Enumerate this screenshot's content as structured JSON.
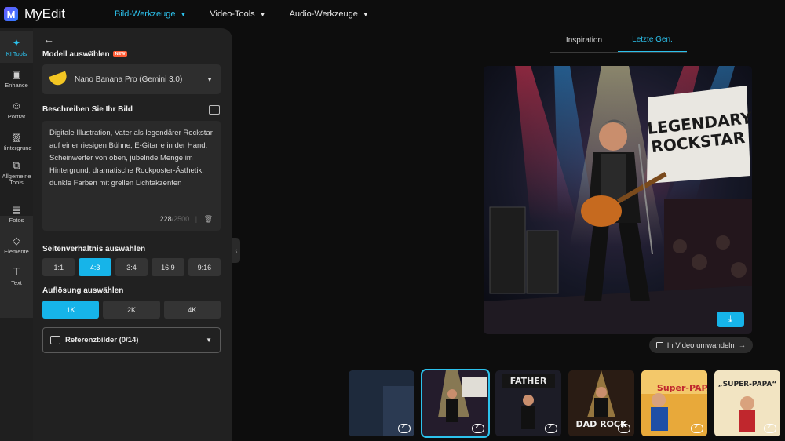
{
  "app": {
    "name": "MyEdit",
    "logo_letter": "M"
  },
  "nav": [
    {
      "label": "Bild-Werkzeuge",
      "active": true
    },
    {
      "label": "Video-Tools",
      "active": false
    },
    {
      "label": "Audio-Werkzeuge",
      "active": false
    }
  ],
  "rail": [
    {
      "label": "KI Tools",
      "icon": "magic-wand-icon",
      "active": true
    },
    {
      "label": "Enhance",
      "icon": "image-enhance-icon"
    },
    {
      "label": "Porträt",
      "icon": "portrait-icon"
    },
    {
      "label": "Hintergrund",
      "icon": "background-icon"
    },
    {
      "label": "Allgemeine Tools",
      "icon": "tools-icon"
    },
    {
      "label": "Fotos",
      "icon": "photos-icon"
    },
    {
      "label": "Elemente",
      "icon": "elements-icon"
    },
    {
      "label": "Text",
      "icon": "text-icon"
    }
  ],
  "panel": {
    "model_title": "Modell auswählen",
    "new_badge": "NEW",
    "model_name": "Nano Banana Pro (Gemini 3.0)",
    "describe_title": "Beschreiben Sie Ihr Bild",
    "prompt": "Digitale Illustration, Vater als legendärer Rockstar auf einer riesigen Bühne, E-Gitarre in der Hand, Scheinwerfer von oben, jubelnde Menge im Hintergrund, dramatische Rockposter-Ästhetik, dunkle Farben mit grellen Lichtakzenten",
    "char_count": "228",
    "char_max": "/2500",
    "ratio_title": "Seitenverhältnis auswählen",
    "ratios": [
      "1:1",
      "4:3",
      "3:4",
      "16:9",
      "9:16"
    ],
    "ratio_selected": "4:3",
    "resolution_title": "Auflösung auswählen",
    "resolutions": [
      "1K",
      "2K",
      "4K"
    ],
    "resolution_selected": "1K",
    "reference_label": "Referenzbilder (0/14)"
  },
  "main": {
    "tabs": [
      "Inspiration",
      "Letzte Gen."
    ],
    "active_tab": "Letzte Gen.",
    "image_text": {
      "line1": "LEGENDARY",
      "line2": "ROCKSTAR"
    },
    "video_button": "In Video umwandeln",
    "thumbnails": [
      {
        "caption": ""
      },
      {
        "caption": "LEGENDARY ROCKSTAR",
        "selected": true
      },
      {
        "caption": "FATHER"
      },
      {
        "caption": "DAD ROCK"
      },
      {
        "caption": "Super-PAPA"
      },
      {
        "caption": "„SUPER-PAPA“"
      }
    ]
  },
  "colors": {
    "accent": "#16b4e9",
    "nav_active": "#2cc1ec",
    "badge": "#ff5c35"
  }
}
